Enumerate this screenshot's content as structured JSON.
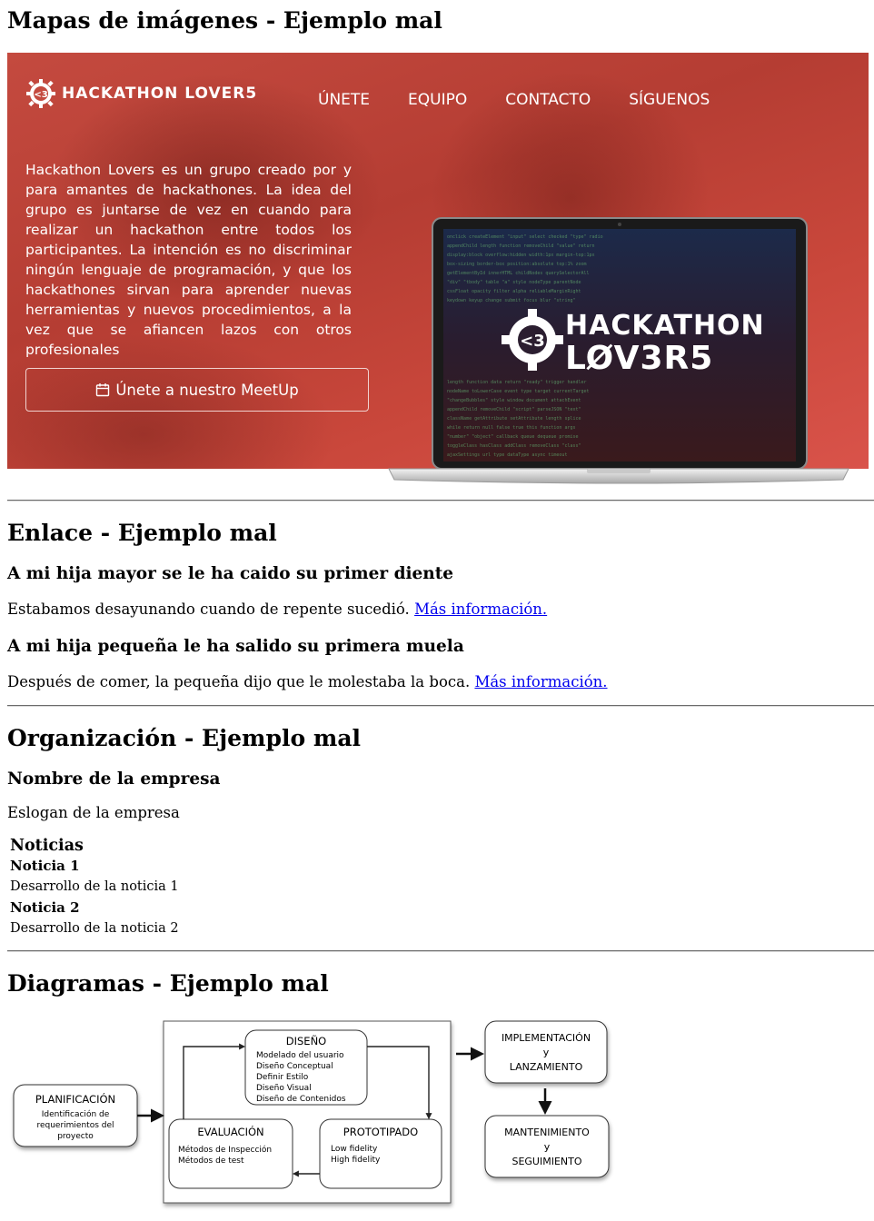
{
  "sections": {
    "imagemap_title": "Mapas de imágenes - Ejemplo mal",
    "link_title": "Enlace - Ejemplo mal",
    "org_title": "Organización - Ejemplo mal",
    "diagram_title": "Diagramas - Ejemplo mal"
  },
  "hero": {
    "logo_text": "HACKATHON LOVER5",
    "logo_badge": "<3",
    "nav": [
      "ÚNETE",
      "EQUIPO",
      "CONTACTO",
      "SÍGUENOS"
    ],
    "description": "Hackathon Lovers es un grupo creado por y para amantes de hackathones. La idea del grupo es juntarse de vez en cuando para realizar un hackathon entre todos los participantes. La intención es no discriminar ningún lenguaje de programación, y que los hackathones sirvan para aprender nuevas herramientas y nuevos procedimientos, a la vez que se afiancen lazos con otros profesionales",
    "button": "Únete a nuestro MeetUp",
    "screen_logo_line1": "HACKATHON",
    "screen_logo_line2": "LØV3R5",
    "screen_badge": "<3"
  },
  "links": {
    "item1_title": "A mi hija mayor se le ha caido su primer diente",
    "item1_text": "Estabamos desayunando cuando de repente sucedió.",
    "item1_link": "Más información.",
    "item2_title": "A mi hija pequeña le ha salido su primera muela",
    "item2_text": "Después de comer, la pequeña dijo que le molestaba la boca.",
    "item2_link": "Más información."
  },
  "org": {
    "company": "Nombre de la empresa",
    "slogan": "Eslogan de la empresa",
    "news_title": "Noticias",
    "news": [
      {
        "title": "Noticia 1",
        "body": "Desarrollo de la noticia 1"
      },
      {
        "title": "Noticia 2",
        "body": "Desarrollo de la noticia 2"
      }
    ]
  },
  "diagram": {
    "planificacion": {
      "title": "PLANIFICACIÓN",
      "lines": [
        "Identificación de",
        "requerimientos del",
        "proyecto"
      ]
    },
    "diseno": {
      "title": "DISEÑO",
      "lines": [
        "Modelado del usuario",
        "Diseño Conceptual",
        "Definir Estilo",
        "Diseño Visual",
        "Diseño de Contenidos"
      ]
    },
    "evaluacion": {
      "title": "EVALUACIÓN",
      "lines": [
        "Métodos de Inspección",
        "Métodos de test"
      ]
    },
    "prototipado": {
      "title": "PROTOTIPADO",
      "lines": [
        "Low fidelity",
        "High fidelity"
      ]
    },
    "implementacion": {
      "lines": [
        "IMPLEMENTACIÓN",
        "y",
        "LANZAMIENTO"
      ]
    },
    "mantenimiento": {
      "lines": [
        "MANTENIMIENTO",
        "y",
        "SEGUIMIENTO"
      ]
    }
  }
}
